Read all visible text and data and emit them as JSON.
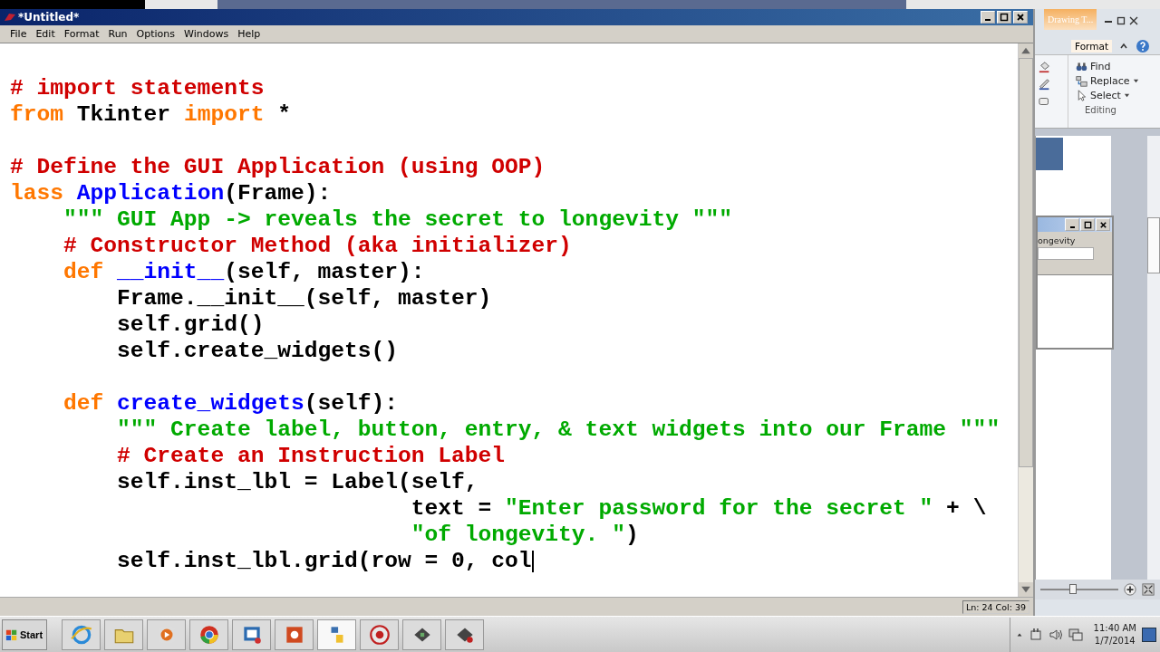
{
  "editor_window": {
    "title": "*Untitled*",
    "menu": [
      "File",
      "Edit",
      "Format",
      "Run",
      "Options",
      "Windows",
      "Help"
    ],
    "code_lines": [
      {
        "kind": "blank"
      },
      {
        "kind": "code",
        "tokens": [
          {
            "kind": "comment",
            "text": "# import statements"
          }
        ]
      },
      {
        "kind": "code",
        "tokens": [
          {
            "kind": "keyword",
            "text": "from"
          },
          {
            "kind": "plain",
            "text": " Tkinter "
          },
          {
            "kind": "keyword",
            "text": "import"
          },
          {
            "kind": "plain",
            "text": " *"
          }
        ]
      },
      {
        "kind": "blank"
      },
      {
        "kind": "code",
        "tokens": [
          {
            "kind": "comment",
            "text": "# Define the GUI Application (using OOP)"
          }
        ]
      },
      {
        "kind": "code",
        "tokens": [
          {
            "kind": "keyword",
            "text": "lass"
          },
          {
            "kind": "definition",
            "text": " Application"
          },
          {
            "kind": "plain",
            "text": "(Frame):"
          }
        ]
      },
      {
        "kind": "code",
        "tokens": [
          {
            "kind": "string",
            "text": "    \"\"\" GUI App -> reveals the secret to longevity \"\"\""
          }
        ]
      },
      {
        "kind": "code",
        "tokens": [
          {
            "kind": "comment",
            "text": "    # Constructor Method (aka initializer)"
          }
        ]
      },
      {
        "kind": "code",
        "tokens": [
          {
            "kind": "keyword",
            "text": "    def"
          },
          {
            "kind": "definition",
            "text": " __init__"
          },
          {
            "kind": "plain",
            "text": "(self, master):"
          }
        ]
      },
      {
        "kind": "code",
        "tokens": [
          {
            "kind": "plain",
            "text": "        Frame.__init__(self, master)"
          }
        ]
      },
      {
        "kind": "code",
        "tokens": [
          {
            "kind": "plain",
            "text": "        self.grid()"
          }
        ]
      },
      {
        "kind": "code",
        "tokens": [
          {
            "kind": "plain",
            "text": "        self.create_widgets()"
          }
        ]
      },
      {
        "kind": "blank"
      },
      {
        "kind": "code",
        "tokens": [
          {
            "kind": "keyword",
            "text": "    def"
          },
          {
            "kind": "definition",
            "text": " create_widgets"
          },
          {
            "kind": "plain",
            "text": "(self):"
          }
        ]
      },
      {
        "kind": "code",
        "tokens": [
          {
            "kind": "string",
            "text": "        \"\"\" Create label, button, entry, & text widgets into our Frame \"\"\""
          }
        ]
      },
      {
        "kind": "code",
        "tokens": [
          {
            "kind": "comment",
            "text": "        # Create an Instruction Label"
          }
        ]
      },
      {
        "kind": "code",
        "tokens": [
          {
            "kind": "plain",
            "text": "        self.inst_lbl = Label(self,"
          }
        ]
      },
      {
        "kind": "code",
        "tokens": [
          {
            "kind": "plain",
            "text": "                              text = "
          },
          {
            "kind": "string",
            "text": "\"Enter password for the secret \""
          },
          {
            "kind": "plain",
            "text": " + \\"
          }
        ]
      },
      {
        "kind": "code",
        "tokens": [
          {
            "kind": "string",
            "text": "                              \"of longevity. \""
          },
          {
            "kind": "plain",
            "text": ")"
          }
        ]
      },
      {
        "kind": "code",
        "tokens": [
          {
            "kind": "plain",
            "text": "        self.inst_lbl.grid(row = 0, col"
          }
        ],
        "cursor": true
      }
    ],
    "status": "Ln: 24 Col: 39"
  },
  "background_window": {
    "tab": "Drawing T...",
    "ribbon_tab": "Format",
    "commands": [
      "Find",
      "Replace",
      "Select"
    ],
    "group_label": "Editing",
    "zoom": {
      "level": 0.42
    }
  },
  "app_window": {
    "label": "ongevity"
  },
  "taskbar": {
    "start": "Start",
    "time": "11:40 AM",
    "date": "1/7/2014"
  }
}
